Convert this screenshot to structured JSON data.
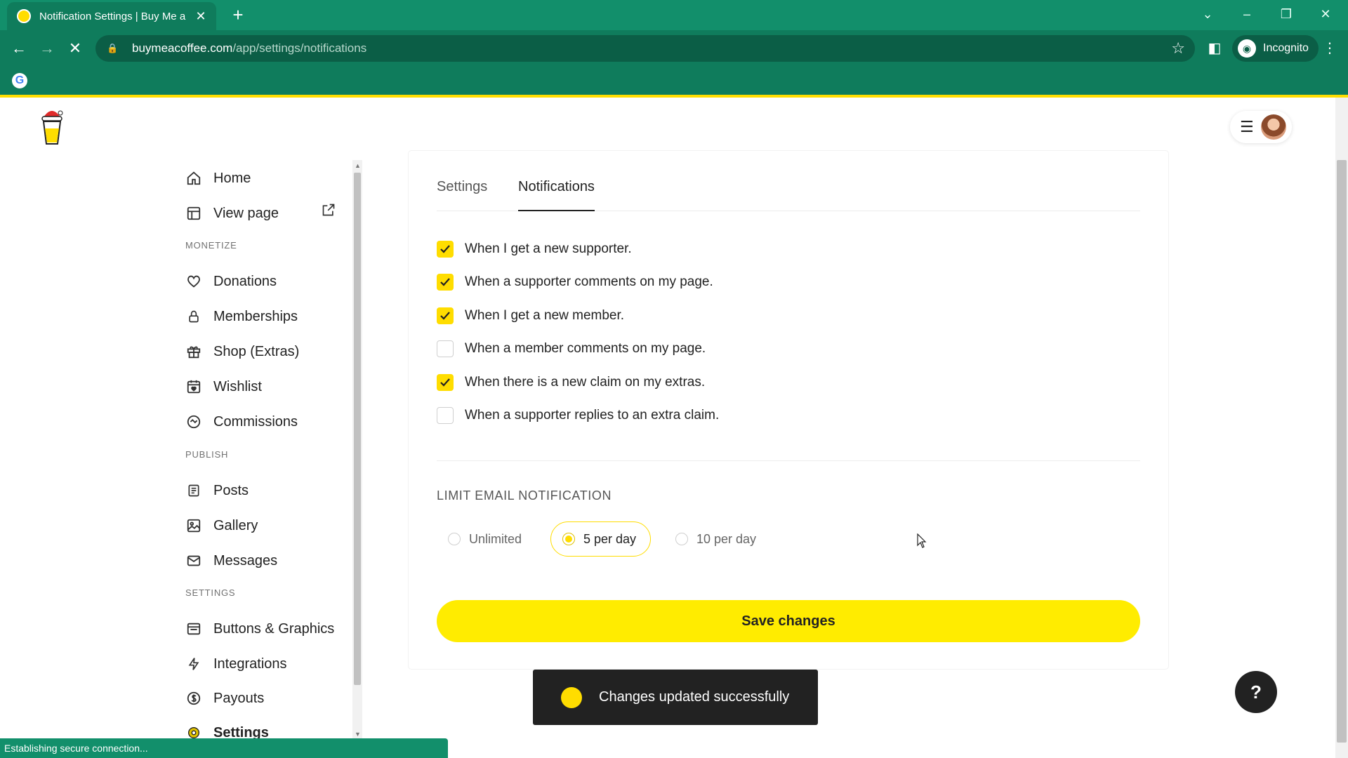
{
  "browser": {
    "tab_title": "Notification Settings | Buy Me a",
    "url_host": "buymeacoffee.com",
    "url_path": "/app/settings/notifications",
    "profile_label": "Incognito",
    "status_text": "Establishing secure connection..."
  },
  "sidebar": {
    "top_items": [
      {
        "label": "Home",
        "icon": "home-icon"
      },
      {
        "label": "View page",
        "icon": "layout-icon"
      }
    ],
    "sections": [
      {
        "title": "MONETIZE",
        "items": [
          {
            "label": "Donations",
            "icon": "heart-icon"
          },
          {
            "label": "Memberships",
            "icon": "lock-icon"
          },
          {
            "label": "Shop (Extras)",
            "icon": "gift-icon"
          },
          {
            "label": "Wishlist",
            "icon": "calendar-heart-icon"
          },
          {
            "label": "Commissions",
            "icon": "handshake-icon"
          }
        ]
      },
      {
        "title": "PUBLISH",
        "items": [
          {
            "label": "Posts",
            "icon": "document-icon"
          },
          {
            "label": "Gallery",
            "icon": "image-icon"
          },
          {
            "label": "Messages",
            "icon": "mail-icon"
          }
        ]
      },
      {
        "title": "SETTINGS",
        "items": [
          {
            "label": "Buttons & Graphics",
            "icon": "window-icon"
          },
          {
            "label": "Integrations",
            "icon": "lightning-icon"
          },
          {
            "label": "Payouts",
            "icon": "dollar-icon"
          },
          {
            "label": "Settings",
            "icon": "gear-icon"
          }
        ]
      }
    ]
  },
  "tabs": [
    {
      "label": "Settings",
      "active": false
    },
    {
      "label": "Notifications",
      "active": true
    }
  ],
  "notifications": [
    {
      "label": "When I get a new supporter.",
      "checked": true
    },
    {
      "label": "When a supporter comments on my page.",
      "checked": true
    },
    {
      "label": "When I get a new member.",
      "checked": true
    },
    {
      "label": "When a member comments on my page.",
      "checked": false
    },
    {
      "label": "When there is a new claim on my extras.",
      "checked": true
    },
    {
      "label": "When a supporter replies to an extra claim.",
      "checked": false
    }
  ],
  "limit": {
    "title": "LIMIT EMAIL NOTIFICATION",
    "options": [
      {
        "label": "Unlimited",
        "selected": false
      },
      {
        "label": "5 per day",
        "selected": true
      },
      {
        "label": "10 per day",
        "selected": false
      }
    ]
  },
  "save_label": "Save changes",
  "toast_text": "Changes updated successfully",
  "help_label": "?",
  "colors": {
    "accent": "#ffdd00",
    "chrome": "#128f6b",
    "dark": "#222222"
  }
}
